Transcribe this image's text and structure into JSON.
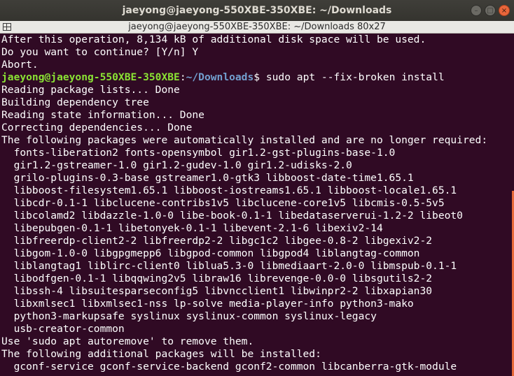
{
  "window": {
    "title": "jaeyong@jaeyong-550XBE-350XBE: ~/Downloads",
    "controls": {
      "minimize": "–",
      "maximize": "□",
      "close": "×"
    }
  },
  "tab": {
    "title": "jaeyong@jaeyong-550XBE-350XBE: ~/Downloads 80x27",
    "icon": "split-terminal-icon"
  },
  "terminal": {
    "colors": {
      "background": "#300a24",
      "text": "#ffffff",
      "prompt_user": "#8ae234",
      "prompt_path": "#729fcf",
      "scroll_indicator": "#e86a3a"
    },
    "prompt": {
      "user_host": "jaeyong@jaeyong-550XBE-350XBE",
      "separator": ":",
      "path": "~/Downloads",
      "symbol": "$",
      "command": " sudo apt --fix-broken install"
    },
    "lines_before": [
      "After this operation, 8,134 kB of additional disk space will be used.",
      "Do you want to continue? [Y/n] Y",
      "Abort."
    ],
    "lines_after": [
      "Reading package lists... Done",
      "Building dependency tree",
      "Reading state information... Done",
      "Correcting dependencies... Done",
      "The following packages were automatically installed and are no longer required:",
      "  fonts-liberation2 fonts-opensymbol gir1.2-gst-plugins-base-1.0",
      "  gir1.2-gstreamer-1.0 gir1.2-gudev-1.0 gir1.2-udisks-2.0",
      "  grilo-plugins-0.3-base gstreamer1.0-gtk3 libboost-date-time1.65.1",
      "  libboost-filesystem1.65.1 libboost-iostreams1.65.1 libboost-locale1.65.1",
      "  libcdr-0.1-1 libclucene-contribs1v5 libclucene-core1v5 libcmis-0.5-5v5",
      "  libcolamd2 libdazzle-1.0-0 libe-book-0.1-1 libedataserverui-1.2-2 libeot0",
      "  libepubgen-0.1-1 libetonyek-0.1-1 libevent-2.1-6 libexiv2-14",
      "  libfreerdp-client2-2 libfreerdp2-2 libgc1c2 libgee-0.8-2 libgexiv2-2",
      "  libgom-1.0-0 libgpgmepp6 libgpod-common libgpod4 liblangtag-common",
      "  liblangtag1 liblirc-client0 liblua5.3-0 libmediaart-2.0-0 libmspub-0.1-1",
      "  libodfgen-0.1-1 libqqwing2v5 libraw16 librevenge-0.0-0 libsgutils2-2",
      "  libssh-4 libsuitesparseconfig5 libvncclient1 libwinpr2-2 libxapian30",
      "  libxmlsec1 libxmlsec1-nss lp-solve media-player-info python3-mako",
      "  python3-markupsafe syslinux syslinux-common syslinux-legacy",
      "  usb-creator-common",
      "Use 'sudo apt autoremove' to remove them.",
      "The following additional packages will be installed:",
      "  gconf-service gconf-service-backend gconf2-common libcanberra-gtk-module"
    ]
  }
}
